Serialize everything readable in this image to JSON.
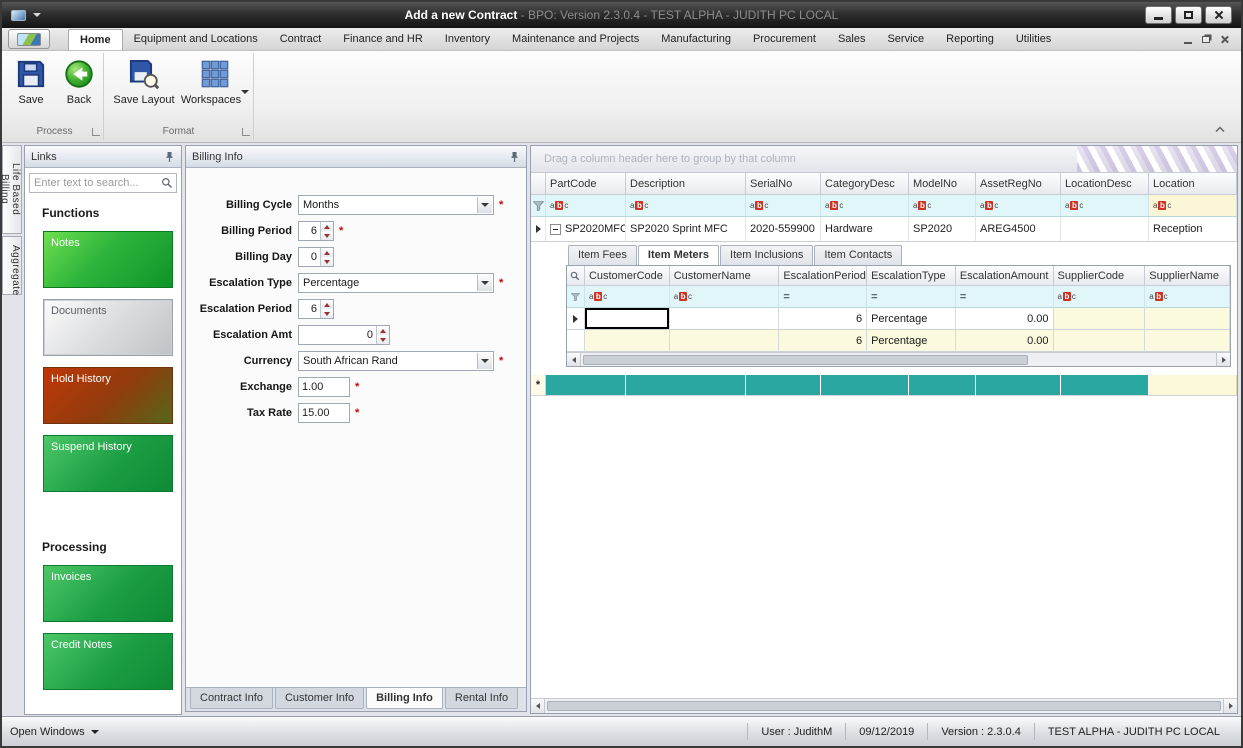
{
  "window": {
    "title": "Add a new Contract",
    "title_suffix": " - BPO: Version 2.3.0.4 - TEST ALPHA - JUDITH PC LOCAL"
  },
  "ribbon": {
    "tabs": [
      {
        "label": "Home"
      },
      {
        "label": "Equipment and Locations"
      },
      {
        "label": "Contract"
      },
      {
        "label": "Finance and HR"
      },
      {
        "label": "Inventory"
      },
      {
        "label": "Maintenance and Projects"
      },
      {
        "label": "Manufacturing"
      },
      {
        "label": "Procurement"
      },
      {
        "label": "Sales"
      },
      {
        "label": "Service"
      },
      {
        "label": "Reporting"
      },
      {
        "label": "Utilities"
      }
    ],
    "buttons": {
      "save": "Save",
      "back": "Back",
      "save_layout": "Save Layout",
      "workspaces": "Workspaces"
    },
    "groups": {
      "process": "Process",
      "format": "Format"
    }
  },
  "side_tabs": {
    "life_based_billing": "Life Based Billing",
    "aggregate": "Aggregate"
  },
  "links": {
    "title": "Links",
    "search_placeholder": "Enter text to search...",
    "functions_heading": "Functions",
    "processing_heading": "Processing",
    "buttons": {
      "notes": "Notes",
      "documents": "Documents",
      "hold_history": "Hold History",
      "suspend_history": "Suspend History",
      "invoices": "Invoices",
      "credit_notes": "Credit Notes"
    }
  },
  "billing": {
    "title": "Billing Info",
    "required_mark": "*",
    "fields": [
      {
        "label": "Billing Cycle",
        "value": "Months"
      },
      {
        "label": "Billing Period",
        "value": "6"
      },
      {
        "label": "Billing Day",
        "value": "0"
      },
      {
        "label": "Escalation Type",
        "value": "Percentage"
      },
      {
        "label": "Escalation Period",
        "value": "6"
      },
      {
        "label": "Escalation Amt",
        "value": "0"
      },
      {
        "label": "Currency",
        "value": "South African Rand"
      },
      {
        "label": "Exchange",
        "value": "1.00"
      },
      {
        "label": "Tax Rate",
        "value": "15.00"
      }
    ],
    "tabs": [
      {
        "label": "Contract Info"
      },
      {
        "label": "Customer Info"
      },
      {
        "label": "Billing Info"
      },
      {
        "label": "Rental Info"
      }
    ]
  },
  "grid": {
    "group_hint": "Drag a column header here to group by that column",
    "new_row_mark": "*",
    "columns": [
      {
        "label": "PartCode"
      },
      {
        "label": "Description"
      },
      {
        "label": "SerialNo"
      },
      {
        "label": "CategoryDesc"
      },
      {
        "label": "ModelNo"
      },
      {
        "label": "AssetRegNo"
      },
      {
        "label": "LocationDesc"
      },
      {
        "label": "Location"
      }
    ],
    "row1": {
      "partcode": "SP2020MFC",
      "description": "SP2020 Sprint MFC",
      "serialno": "2020-559900",
      "categorydesc": "Hardware",
      "modelno": "SP2020",
      "assetregno": "AREG4500",
      "locationdesc": "",
      "location": "Reception"
    },
    "detail": {
      "tabs": [
        {
          "label": "Item Fees"
        },
        {
          "label": "Item Meters"
        },
        {
          "label": "Item Inclusions"
        },
        {
          "label": "Item Contacts"
        }
      ],
      "columns": [
        {
          "label": "CustomerCode"
        },
        {
          "label": "CustomerName"
        },
        {
          "label": "EscalationPeriod"
        },
        {
          "label": "EscalationType"
        },
        {
          "label": "EscalationAmount"
        },
        {
          "label": "SupplierCode"
        },
        {
          "label": "SupplierName"
        }
      ],
      "rows": [
        {
          "customercode": "",
          "customername": "",
          "escalationperiod": "6",
          "escalationtype": "Percentage",
          "escalationamount": "0.00",
          "suppliercode": "",
          "suppliername": ""
        },
        {
          "customercode": "",
          "customername": "",
          "escalationperiod": "6",
          "escalationtype": "Percentage",
          "escalationamount": "0.00",
          "suppliercode": "",
          "suppliername": ""
        }
      ]
    }
  },
  "statusbar": {
    "open_windows": "Open Windows",
    "user": "User : JudithM",
    "date": "09/12/2019",
    "version": "Version : 2.3.0.4",
    "environment": "TEST ALPHA - JUDITH PC LOCAL"
  },
  "icons": {
    "abc": [
      "a",
      "b",
      "c"
    ],
    "equals": "="
  }
}
